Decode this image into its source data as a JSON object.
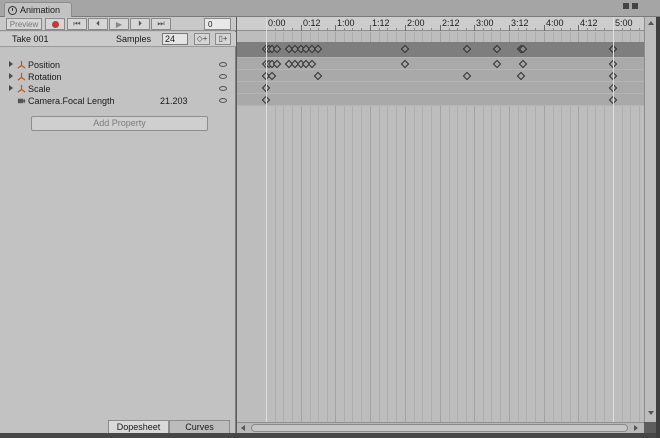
{
  "window": {
    "tab_title": "Animation"
  },
  "toolbar": {
    "preview_label": "Preview",
    "frame_value": "0"
  },
  "clip": {
    "name": "Take 001",
    "samples_label": "Samples",
    "samples_value": "24"
  },
  "properties": [
    {
      "name": "Position",
      "value": ""
    },
    {
      "name": "Rotation",
      "value": ""
    },
    {
      "name": "Scale",
      "value": ""
    },
    {
      "name": "Camera.Focal Length",
      "value": "21.203"
    }
  ],
  "add_property_label": "Add Property",
  "bottom_tabs": {
    "dopesheet": "Dopesheet",
    "curves": "Curves"
  },
  "timeline": {
    "ruler_labels": [
      "0:00",
      "0:12",
      "1:00",
      "1:12",
      "2:00",
      "2:12",
      "3:00",
      "3:12",
      "4:00",
      "4:12",
      "5:00"
    ],
    "keyframe_times": {
      "summary": [
        0.0,
        0.04,
        0.08,
        0.16,
        0.33,
        0.42,
        0.5,
        0.58,
        0.67,
        0.75,
        2.0,
        2.9,
        3.33,
        3.67,
        3.71,
        5.0
      ],
      "position": [
        0.0,
        0.04,
        0.08,
        0.16,
        0.33,
        0.42,
        0.5,
        0.58,
        0.67,
        2.0,
        3.33,
        3.71,
        5.0
      ],
      "rotation": [
        0.0,
        0.08,
        0.75,
        2.9,
        3.67,
        5.0
      ],
      "scale": [
        0.0,
        5.0
      ],
      "focal_length": [
        0.0,
        5.0
      ]
    }
  }
}
